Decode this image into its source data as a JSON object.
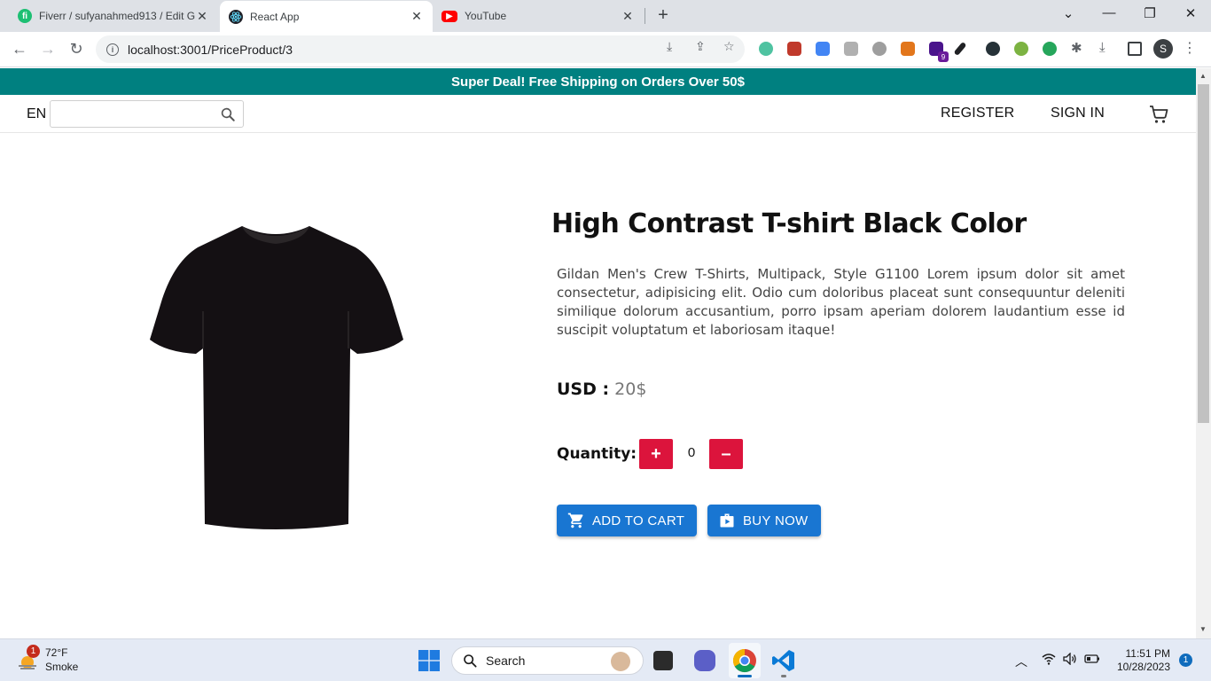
{
  "browser": {
    "tabs": [
      {
        "title": "Fiverr / sufyanahmed913 / Edit G",
        "favicon": "fiverr-icon"
      },
      {
        "title": "React App",
        "favicon": "react-icon"
      },
      {
        "title": "YouTube",
        "favicon": "youtube-icon"
      }
    ],
    "url": "localhost:3001/PriceProduct/3",
    "extension_badge": "9",
    "profile_initial": "S"
  },
  "promo": {
    "text": "Super Deal! Free Shipping on Orders Over 50$"
  },
  "navbar": {
    "language": "EN",
    "search_placeholder": "",
    "register_label": "REGISTER",
    "signin_label": "SIGN IN"
  },
  "product": {
    "title": "High Contrast T-shirt Black Color",
    "description": "Gildan Men's Crew T-Shirts, Multipack, Style G1100 Lorem ipsum dolor sit amet consectetur, adipisicing elit. Odio cum doloribus placeat sunt consequuntur deleniti similique dolorum accusantium, porro ipsam aperiam dolorem laudantium esse id suscipit voluptatum et laboriosam itaque!",
    "price_label": "USD :",
    "price_value": "20$",
    "quantity_label": "Quantity:",
    "quantity": "0",
    "plus_label": "+",
    "minus_label": "–",
    "add_to_cart_label": "ADD TO CART",
    "buy_now_label": "BUY NOW"
  },
  "taskbar": {
    "weather_temp": "72°F",
    "weather_desc": "Smoke",
    "weather_badge": "1",
    "search_label": "Search",
    "time": "11:51 PM",
    "date": "10/28/2023",
    "notification_count": "1"
  },
  "colors": {
    "promo_bg": "#008080",
    "quantity_button": "#dc143c",
    "cta_button": "#1976d2"
  }
}
